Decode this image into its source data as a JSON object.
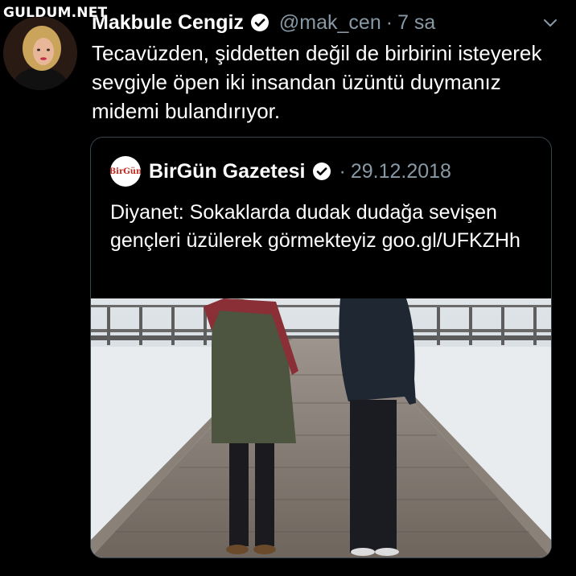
{
  "watermark": "GULDUM.NET",
  "tweet": {
    "author_name": "Makbule Cengiz",
    "handle": "@mak_cen",
    "separator": "·",
    "time": "7 sa",
    "text": "Tecavüzden, şiddetten değil de birbirini isteyerek sevgiyle öpen iki insandan üzüntü duymanız midemi bulandırıyor."
  },
  "quote": {
    "logo_text": "BirGün",
    "author_name": "BirGün Gazetesi",
    "separator": "·",
    "date": "29.12.2018",
    "text": "Diyanet: Sokaklarda dudak dudağa sevişen gençleri üzülerek görmekteyiz goo.gl/UFKZHh"
  },
  "icons": {
    "verified": "verified-badge-icon",
    "more": "chevron-down-icon"
  },
  "colors": {
    "background": "#000000",
    "secondary_text": "#8899a6",
    "border": "#38444d",
    "logo_red": "#c0281e"
  }
}
